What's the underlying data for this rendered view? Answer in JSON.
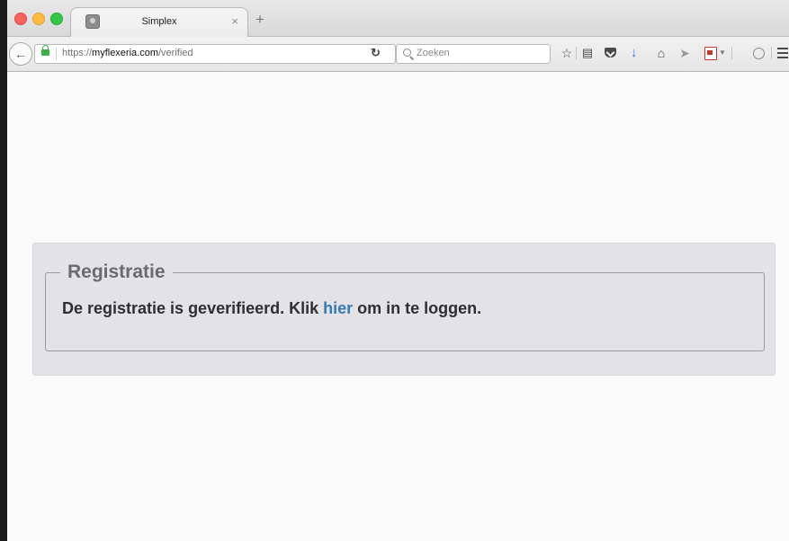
{
  "browser": {
    "tab": {
      "title": "Simplex",
      "close_glyph": "×"
    },
    "new_tab_glyph": "+",
    "url": {
      "scheme": "https://",
      "domain": "myflexeria.com",
      "path": "/verified"
    },
    "search": {
      "placeholder": "Zoeken"
    },
    "icons": [
      "back-arrow-icon",
      "lock-icon",
      "reload-icon",
      "search-icon",
      "star-icon",
      "reading-list-icon",
      "pocket-icon",
      "download-icon",
      "home-icon",
      "send-icon",
      "pdf-icon",
      "chevron-down-icon",
      "chat-icon",
      "menu-icon"
    ],
    "colors": {
      "lock": "#3bb04a",
      "download": "#2f7de1",
      "link": "#337ab7"
    }
  },
  "page": {
    "panel": {
      "legend": "Registratie",
      "message_before": "De registratie is geverifieerd. Klik ",
      "link_text": "hier",
      "message_after": " om in te loggen."
    }
  }
}
